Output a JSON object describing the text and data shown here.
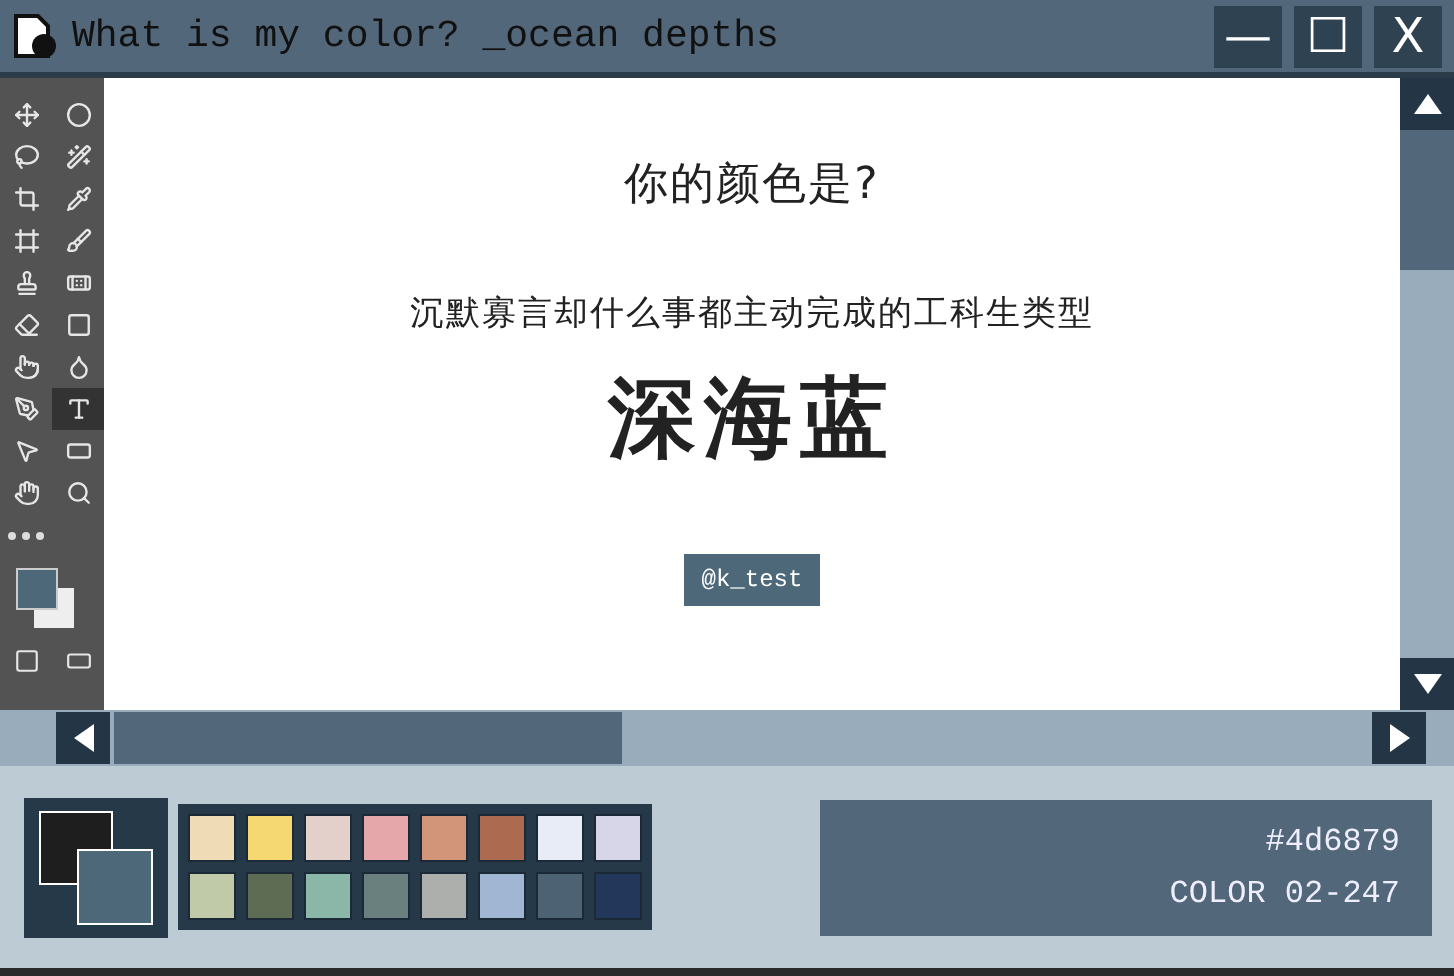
{
  "window": {
    "title": "What is my color? _ocean depths",
    "controls": [
      "—",
      "☐",
      "X"
    ]
  },
  "toolbox": {
    "tools": [
      {
        "selected": false
      },
      {
        "selected": false
      },
      {
        "selected": false
      },
      {
        "selected": false
      },
      {
        "selected": false
      },
      {
        "selected": false
      },
      {
        "selected": false
      },
      {
        "selected": false
      },
      {
        "selected": false
      },
      {
        "selected": false
      },
      {
        "selected": false
      },
      {
        "selected": false
      },
      {
        "selected": false
      },
      {
        "selected": false
      },
      {
        "selected": false
      },
      {
        "selected": true
      },
      {
        "selected": false
      },
      {
        "selected": false
      },
      {
        "selected": false
      },
      {
        "selected": false
      }
    ]
  },
  "canvas": {
    "question": "你的颜色是?",
    "description": "沉默寡言却什么事都主动完成的工科生类型",
    "result": "深海蓝",
    "tag": "@k_test"
  },
  "palette": [
    {
      "color": "#efdbb5"
    },
    {
      "color": "#f6d873"
    },
    {
      "color": "#e4d0cb"
    },
    {
      "color": "#e5a7aa"
    },
    {
      "color": "#d2957a"
    },
    {
      "color": "#ac6b51"
    },
    {
      "color": "#e8ecf7"
    },
    {
      "color": "#d7d6e8"
    },
    {
      "color": "#c0caa8"
    },
    {
      "color": "#5f6c54"
    },
    {
      "color": "#8bb7a8"
    },
    {
      "color": "#6a807e"
    },
    {
      "color": "#acafac"
    },
    {
      "color": "#a1b6d2"
    },
    {
      "color": "#4d6373"
    },
    {
      "color": "#22375a"
    }
  ],
  "info": {
    "hex": "#4d6879",
    "code": "COLOR 02-247"
  }
}
